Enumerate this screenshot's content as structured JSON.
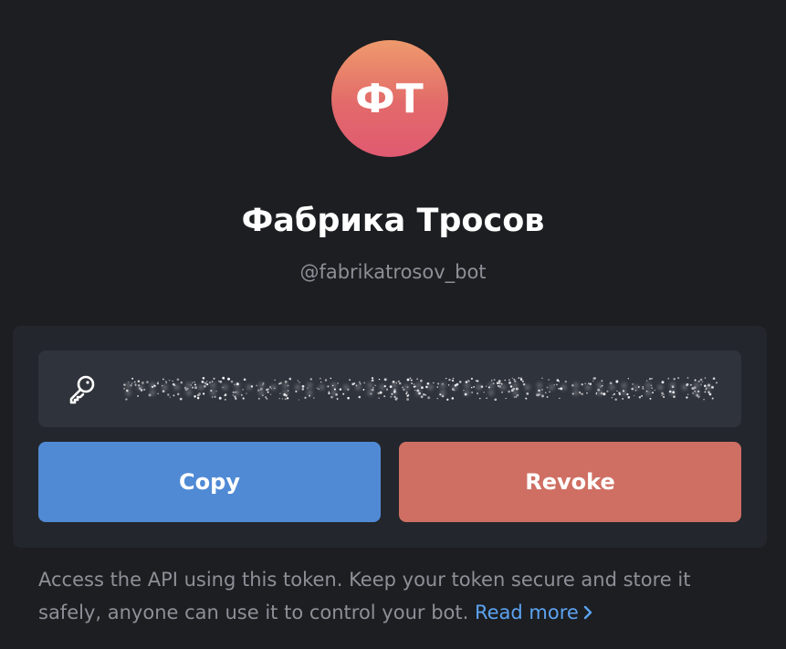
{
  "bot": {
    "avatar_initials": "ФТ",
    "name": "Фабрика Тросов",
    "username": "@fabrikatrosov_bot"
  },
  "token": {
    "icon": "key-icon",
    "masked_value": ":·:··:·:·:·:·:·:·:··:·:·:·:·:·:·:·:··:·:·:·:·:·:·:·"
  },
  "actions": {
    "copy_label": "Copy",
    "revoke_label": "Revoke"
  },
  "footer": {
    "description": "Access the API using this token. Keep your token secure and store it safely, anyone can use it to control your bot.",
    "read_more_label": "Read more",
    "read_more_icon": "chevron-right-icon"
  },
  "colors": {
    "background": "#1c1e22",
    "card": "#23262d",
    "field": "#2f333b",
    "copy_button": "#508ad5",
    "revoke_button": "#cf6f63",
    "link": "#5ca3f1",
    "avatar_gradient_top": "#ee9a6c",
    "avatar_gradient_bottom": "#e05a71"
  }
}
